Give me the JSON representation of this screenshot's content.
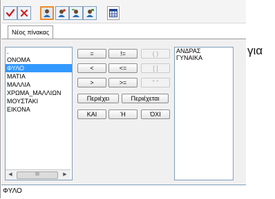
{
  "toolbar": {
    "buttons": [
      {
        "icon": "checkmark-icon",
        "color": "#cc2222"
      },
      {
        "icon": "close-x-icon",
        "color": "#cc2222"
      },
      {
        "icon": "figure-icon"
      },
      {
        "icon": "figure-add-icon"
      },
      {
        "icon": "figure-arrow-icon"
      },
      {
        "icon": "figure-tag-icon"
      },
      {
        "icon": "table-grid-icon"
      }
    ]
  },
  "tab": {
    "label": "Νέος πίνακας"
  },
  "fields": {
    "items": [
      ".",
      "ΟΝΟΜΑ",
      "ΦΥΛΟ",
      "ΜΑΤΙΑ",
      "ΜΑΛΛΙΑ",
      "ΧΡΩΜΑ_ΜΑΛΛΙΩΝ",
      "ΜΟΥΣΤΑΚΙ",
      "ΕΙΚΟΝΑ"
    ],
    "selected": "ΦΥΛΟ",
    "scroll_thumb": "III"
  },
  "operators": {
    "eq": "=",
    "neq": "!=",
    "paren": "( )",
    "lt": "<",
    "lte": "<=",
    "bracket": "[ ]",
    "gt": ">",
    "gte": ">=",
    "quote": "\" \"",
    "contains": "Περιέχει",
    "contained": "Περιέχεται",
    "and": "ΚΑΙ",
    "or": "Ή",
    "not": "ΌΧΙ"
  },
  "values": {
    "items": [
      "ΑΝΔΡΑΣ",
      "ΓΥΝΑΙΚΑ"
    ]
  },
  "expression": {
    "text": "ΦΥΛΟ"
  },
  "side_text": "για",
  "colors": {
    "selection": "#3399ff",
    "accent_red": "#cc2222",
    "pressed_outline": "#ee8a2a",
    "list_border": "#7f9db9"
  }
}
